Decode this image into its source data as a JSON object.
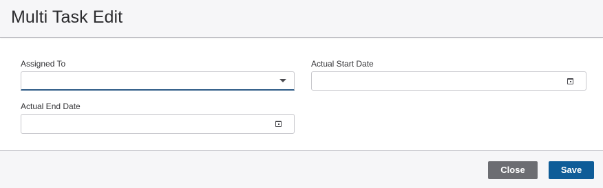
{
  "dialog": {
    "title": "Multi Task Edit"
  },
  "fields": {
    "assigned_to": {
      "label": "Assigned To",
      "value": ""
    },
    "actual_start_date": {
      "label": "Actual Start Date",
      "value": ""
    },
    "actual_end_date": {
      "label": "Actual End Date",
      "value": ""
    }
  },
  "footer": {
    "close_label": "Close",
    "save_label": "Save"
  },
  "icons": {
    "dropdown": "chevron-down-icon",
    "date": "calendar-icon"
  },
  "colors": {
    "accent": "#0e5c98",
    "focus_underline": "#2d5a86",
    "secondary_button": "#6c6d72",
    "header_bg": "#f6f6f8"
  }
}
